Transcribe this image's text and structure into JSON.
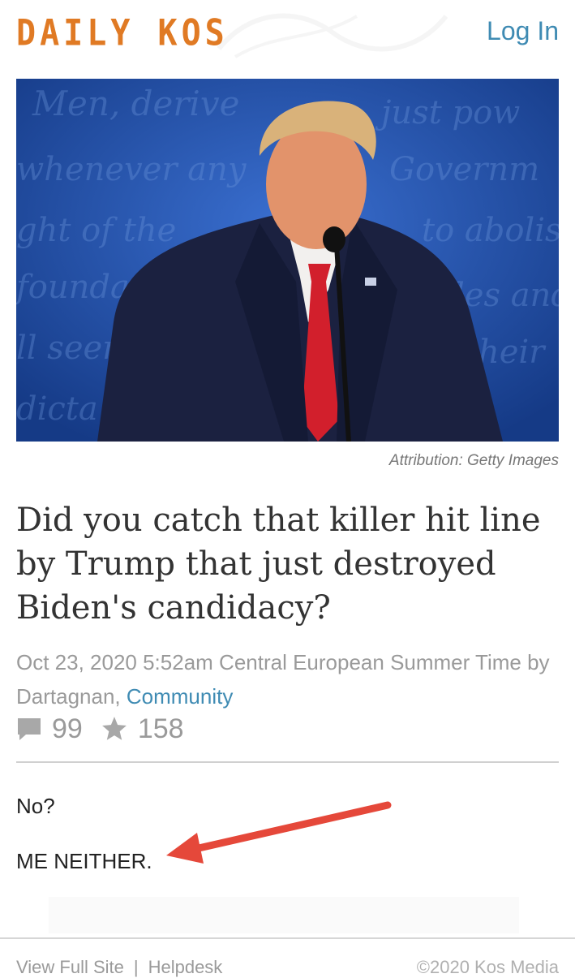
{
  "header": {
    "logo_text": "DAILY KOS",
    "login_label": "Log In",
    "brand_color": "#e07a24",
    "link_color": "#3f8bb3"
  },
  "hero": {
    "image_description": "photo",
    "attribution": "Attribution: Getty Images"
  },
  "article": {
    "title": "Did you catch that killer hit line by Trump that just destroyed Biden's candidacy?",
    "meta_prefix": "Oct 23, 2020 5:52am Central European Summer Time by Dartagnan, ",
    "category": "Community",
    "comments_count": "99",
    "recommends_count": "158",
    "comment_icon": "comment-icon",
    "star_icon": "star-icon",
    "paragraphs": [
      "No?",
      "ME NEITHER."
    ]
  },
  "annotation": {
    "arrow_color": "#e5483a"
  },
  "footer": {
    "view_full_site": "View Full Site",
    "separator": "|",
    "helpdesk": "Helpdesk",
    "copyright": "©2020 Kos Media"
  }
}
